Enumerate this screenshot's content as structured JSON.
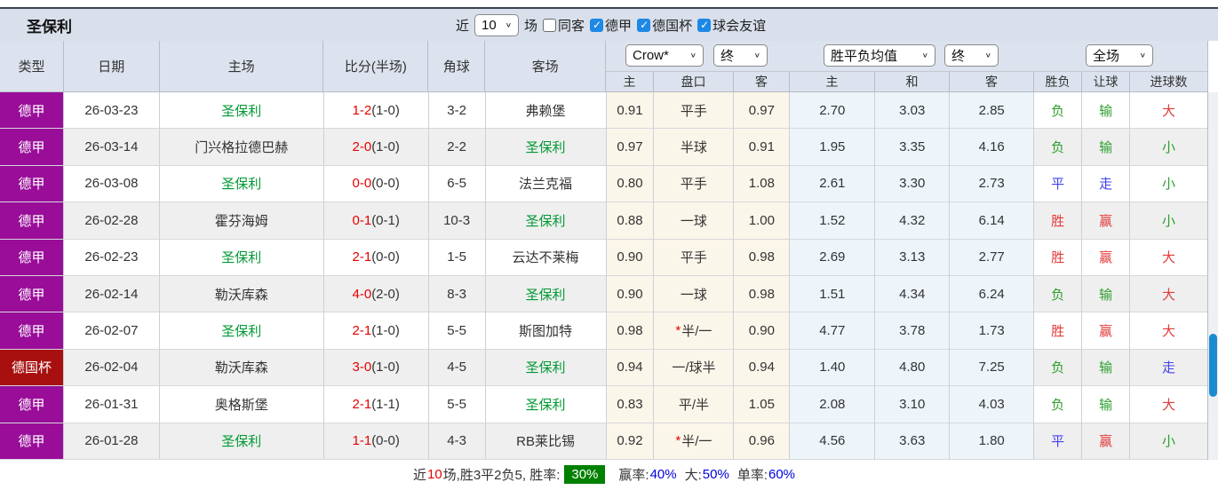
{
  "colors": {
    "league-purple": "#990d99",
    "league-cup": "#a81010",
    "team-green": "#009933",
    "score-red": "#e80000",
    "win-red": "#e23b3b",
    "loss-green": "#2e9e2e",
    "draw-blue": "#4343ef",
    "badge-green": "#008000",
    "value-blue": "#0000dd",
    "scrollbar-blue": "#1b8bd0",
    "stripe": "#efefef",
    "cream": "#fbf6ea",
    "lightblue": "#edf5fa"
  },
  "titlebar": {
    "team": "圣保利",
    "recent_label": "近",
    "recent_value": "10",
    "games_label": "场",
    "same_venue_label": "同客",
    "leagues": [
      {
        "label": "德甲",
        "checked": true
      },
      {
        "label": "德国杯",
        "checked": true
      },
      {
        "label": "球会友谊",
        "checked": true
      }
    ]
  },
  "header": {
    "col_type": "类型",
    "col_date": "日期",
    "col_home": "主场",
    "col_score": "比分(半场)",
    "col_corner": "角球",
    "col_away": "客场",
    "odds_source_select": "Crow*",
    "odds_time_select": "终",
    "avg_source_select": "胜平负均值",
    "avg_time_select": "终",
    "scope_select": "全场",
    "sub": {
      "home": "主",
      "handicap": "盘口",
      "away": "客",
      "avg_home": "主",
      "avg_draw": "和",
      "avg_away": "客",
      "wdl": "胜负",
      "handicap_result": "让球",
      "goals": "进球数"
    }
  },
  "rows": [
    {
      "league": "德甲",
      "league_type": "league",
      "date": "26-03-23",
      "home": "圣保利",
      "score": "1-2",
      "half": "(1-0)",
      "corner": "3-2",
      "away": "弗赖堡",
      "odds_home": "0.91",
      "handicap": "平手",
      "handicap_star": false,
      "odds_away": "0.97",
      "avg_home": "2.70",
      "avg_draw": "3.03",
      "avg_away": "2.85",
      "wdl": "负",
      "wdl_color": "green",
      "handicap_result": "输",
      "handicap_result_color": "green",
      "goals": "大",
      "goals_color": "red"
    },
    {
      "league": "德甲",
      "league_type": "league",
      "date": "26-03-14",
      "home": "门兴格拉德巴赫",
      "score": "2-0",
      "half": "(1-0)",
      "corner": "2-2",
      "away": "圣保利",
      "odds_home": "0.97",
      "handicap": "半球",
      "handicap_star": false,
      "odds_away": "0.91",
      "avg_home": "1.95",
      "avg_draw": "3.35",
      "avg_away": "4.16",
      "wdl": "负",
      "wdl_color": "green",
      "handicap_result": "输",
      "handicap_result_color": "green",
      "goals": "小",
      "goals_color": "green"
    },
    {
      "league": "德甲",
      "league_type": "league",
      "date": "26-03-08",
      "home": "圣保利",
      "score": "0-0",
      "half": "(0-0)",
      "corner": "6-5",
      "away": "法兰克福",
      "odds_home": "0.80",
      "handicap": "平手",
      "handicap_star": false,
      "odds_away": "1.08",
      "avg_home": "2.61",
      "avg_draw": "3.30",
      "avg_away": "2.73",
      "wdl": "平",
      "wdl_color": "blue",
      "handicap_result": "走",
      "handicap_result_color": "blue",
      "goals": "小",
      "goals_color": "green"
    },
    {
      "league": "德甲",
      "league_type": "league",
      "date": "26-02-28",
      "home": "霍芬海姆",
      "score": "0-1",
      "half": "(0-1)",
      "corner": "10-3",
      "away": "圣保利",
      "odds_home": "0.88",
      "handicap": "一球",
      "handicap_star": false,
      "odds_away": "1.00",
      "avg_home": "1.52",
      "avg_draw": "4.32",
      "avg_away": "6.14",
      "wdl": "胜",
      "wdl_color": "red",
      "handicap_result": "赢",
      "handicap_result_color": "red",
      "goals": "小",
      "goals_color": "green"
    },
    {
      "league": "德甲",
      "league_type": "league",
      "date": "26-02-23",
      "home": "圣保利",
      "score": "2-1",
      "half": "(0-0)",
      "corner": "1-5",
      "away": "云达不莱梅",
      "odds_home": "0.90",
      "handicap": "平手",
      "handicap_star": false,
      "odds_away": "0.98",
      "avg_home": "2.69",
      "avg_draw": "3.13",
      "avg_away": "2.77",
      "wdl": "胜",
      "wdl_color": "red",
      "handicap_result": "赢",
      "handicap_result_color": "red",
      "goals": "大",
      "goals_color": "red"
    },
    {
      "league": "德甲",
      "league_type": "league",
      "date": "26-02-14",
      "home": "勒沃库森",
      "score": "4-0",
      "half": "(2-0)",
      "corner": "8-3",
      "away": "圣保利",
      "odds_home": "0.90",
      "handicap": "一球",
      "handicap_star": false,
      "odds_away": "0.98",
      "avg_home": "1.51",
      "avg_draw": "4.34",
      "avg_away": "6.24",
      "wdl": "负",
      "wdl_color": "green",
      "handicap_result": "输",
      "handicap_result_color": "green",
      "goals": "大",
      "goals_color": "red"
    },
    {
      "league": "德甲",
      "league_type": "league",
      "date": "26-02-07",
      "home": "圣保利",
      "score": "2-1",
      "half": "(1-0)",
      "corner": "5-5",
      "away": "斯图加特",
      "odds_home": "0.98",
      "handicap": "半/一",
      "handicap_star": true,
      "odds_away": "0.90",
      "avg_home": "4.77",
      "avg_draw": "3.78",
      "avg_away": "1.73",
      "wdl": "胜",
      "wdl_color": "red",
      "handicap_result": "赢",
      "handicap_result_color": "red",
      "goals": "大",
      "goals_color": "red"
    },
    {
      "league": "德国杯",
      "league_type": "cup",
      "date": "26-02-04",
      "home": "勒沃库森",
      "score": "3-0",
      "half": "(1-0)",
      "corner": "4-5",
      "away": "圣保利",
      "odds_home": "0.94",
      "handicap": "一/球半",
      "handicap_star": false,
      "odds_away": "0.94",
      "avg_home": "1.40",
      "avg_draw": "4.80",
      "avg_away": "7.25",
      "wdl": "负",
      "wdl_color": "green",
      "handicap_result": "输",
      "handicap_result_color": "green",
      "goals": "走",
      "goals_color": "blue"
    },
    {
      "league": "德甲",
      "league_type": "league",
      "date": "26-01-31",
      "home": "奥格斯堡",
      "score": "2-1",
      "half": "(1-1)",
      "corner": "5-5",
      "away": "圣保利",
      "odds_home": "0.83",
      "handicap": "平/半",
      "handicap_star": false,
      "odds_away": "1.05",
      "avg_home": "2.08",
      "avg_draw": "3.10",
      "avg_away": "4.03",
      "wdl": "负",
      "wdl_color": "green",
      "handicap_result": "输",
      "handicap_result_color": "green",
      "goals": "大",
      "goals_color": "red"
    },
    {
      "league": "德甲",
      "league_type": "league",
      "date": "26-01-28",
      "home": "圣保利",
      "score": "1-1",
      "half": "(0-0)",
      "corner": "4-3",
      "away": "RB莱比锡",
      "odds_home": "0.92",
      "handicap": "半/一",
      "handicap_star": true,
      "odds_away": "0.96",
      "avg_home": "4.56",
      "avg_draw": "3.63",
      "avg_away": "1.80",
      "wdl": "平",
      "wdl_color": "blue",
      "handicap_result": "赢",
      "handicap_result_color": "red",
      "goals": "小",
      "goals_color": "green"
    }
  ],
  "footer": {
    "prefix": "近",
    "count": "10",
    "summary": "场,胜3平2负5, 胜率:",
    "win_rate": "30%",
    "stats": [
      {
        "label": "赢率:",
        "value": "40%"
      },
      {
        "label": "大:",
        "value": "50%"
      },
      {
        "label": "单率:",
        "value": "60%"
      }
    ]
  }
}
